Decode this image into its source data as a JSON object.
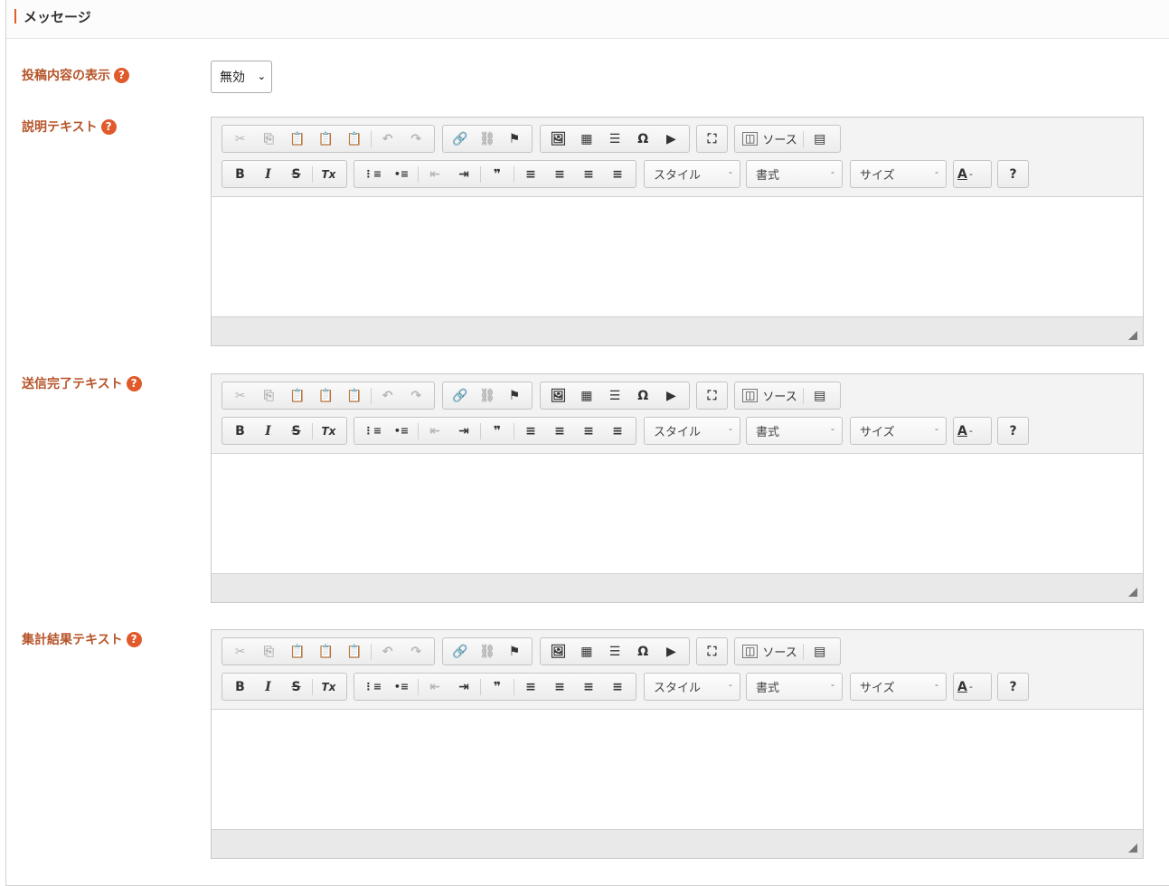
{
  "section": {
    "title": "メッセージ"
  },
  "display_setting": {
    "label": "投稿内容の表示",
    "help": "?",
    "value": "無効",
    "chevron": "⌄"
  },
  "editors": [
    {
      "label": "説明テキスト",
      "help": "?"
    },
    {
      "label": "送信完了テキスト",
      "help": "?"
    },
    {
      "label": "集計結果テキスト",
      "help": "?"
    }
  ],
  "toolbar": {
    "cut": "✂",
    "copy": "⎘",
    "paste": "📋",
    "paste_text": "📋",
    "paste_word": "📋",
    "undo": "↶",
    "redo": "↷",
    "link": "🔗",
    "unlink": "⛓",
    "anchor": "⚑",
    "image": "🖼",
    "table": "▦",
    "hr": "☰",
    "special_char": "Ω",
    "youtube": "▶",
    "maximize": "⛶",
    "source_label": "ソース",
    "source_icon": "◫",
    "templates": "▤",
    "bold": "B",
    "italic": "I",
    "strike": "S",
    "remove_format": "Tx",
    "numbered_list": "⋮≡",
    "bulleted_list": "•≡",
    "outdent": "⇤",
    "indent": "⇥",
    "blockquote": "❞",
    "align_left": "≡",
    "align_center": "≡",
    "align_right": "≡",
    "align_justify": "≡",
    "styles_label": "スタイル",
    "format_label": "書式",
    "size_label": "サイズ",
    "combo_arrow": "-",
    "text_color": "A",
    "text_color_arrow": "-",
    "help": "?"
  }
}
